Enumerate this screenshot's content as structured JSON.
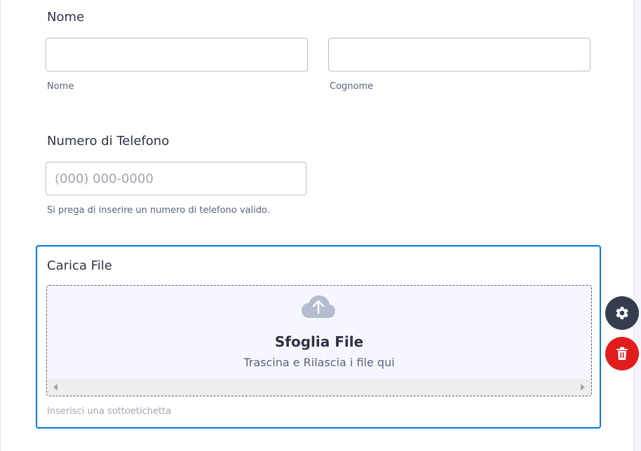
{
  "name_field": {
    "question": "Nome",
    "first_value": "",
    "last_value": "",
    "first_sublabel": "Nome",
    "last_sublabel": "Cognome"
  },
  "phone_field": {
    "question": "Numero di Telefono",
    "value": "",
    "placeholder": "(000) 000-0000",
    "hint": "Si prega di inserire un numero di telefono valido."
  },
  "upload_field": {
    "question": "Carica File",
    "browse_title": "Sfoglia File",
    "browse_subtitle": "Trascina e Rilascia i file qui",
    "sublabel_placeholder": "Inserisci una sottoetichetta",
    "upload_icon": "cloud-upload-icon"
  },
  "floating_actions": {
    "settings_icon": "gear-icon",
    "delete_icon": "trash-icon",
    "settings_color": "#343c4e",
    "delete_color": "#e11c1c"
  },
  "colors": {
    "selected_border": "#0075e3",
    "text_primary": "#2c3345",
    "text_secondary": "#57647e"
  }
}
